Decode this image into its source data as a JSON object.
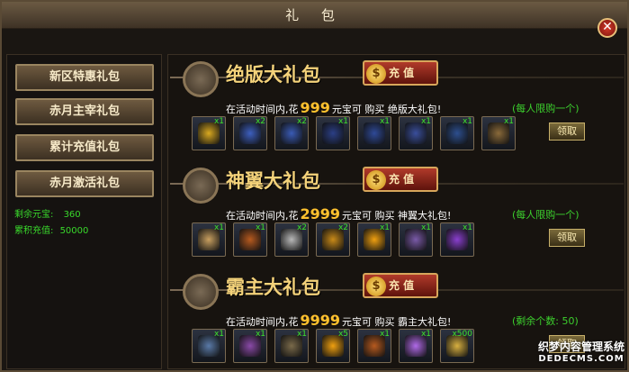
{
  "window": {
    "title": "礼 包",
    "close_glyph": "✕"
  },
  "sidebar": {
    "items": [
      {
        "label": "新区特惠礼包"
      },
      {
        "label": "赤月主宰礼包"
      },
      {
        "label": "累计充值礼包"
      },
      {
        "label": "赤月激活礼包"
      }
    ],
    "remaining_label": "剩余元宝:",
    "remaining_value": "360",
    "total_label": "累积充值:",
    "total_value": "50000"
  },
  "packs": [
    {
      "title": "绝版大礼包",
      "charge_label": "充 值",
      "desc_prefix": "在活动时间内,花",
      "price": "999",
      "desc_suffix": "元宝可 购买 绝版大礼包!",
      "limit": "(每人限购一个)",
      "claim_label": "领取",
      "items": [
        {
          "icon": "gold-token-icon",
          "count": "x1",
          "color": "#d9a920"
        },
        {
          "icon": "gold-helmet-icon",
          "count": "x2",
          "color": "#3d5fbf"
        },
        {
          "icon": "blue-armor-icon",
          "count": "x2",
          "color": "#3a5bb5"
        },
        {
          "icon": "gold-armor-icon",
          "count": "x1",
          "color": "#2b3f86"
        },
        {
          "icon": "gauntlet-icon",
          "count": "x1",
          "color": "#2f4a98"
        },
        {
          "icon": "gold-boots-icon",
          "count": "x1",
          "color": "#3a4f9c"
        },
        {
          "icon": "blue-weapon-icon",
          "count": "x1",
          "color": "#2d4f8f"
        },
        {
          "icon": "treasure-chest-icon",
          "count": "x1",
          "color": "#8a6a3a"
        }
      ]
    },
    {
      "title": "神翼大礼包",
      "charge_label": "充 值",
      "desc_prefix": "在活动时间内,花",
      "price": "2999",
      "desc_suffix": "元宝可 购买 神翼大礼包!",
      "limit": "(每人限购一个)",
      "claim_label": "领取",
      "items": [
        {
          "icon": "wings-icon",
          "count": "x1",
          "color": "#c9a060"
        },
        {
          "icon": "scroll-icon",
          "count": "x1",
          "color": "#b75a1f"
        },
        {
          "icon": "white-scroll-icon",
          "count": "x2",
          "color": "#b8b8b8"
        },
        {
          "icon": "gold-scroll-icon",
          "count": "x2",
          "color": "#c98a18"
        },
        {
          "icon": "gold-coupon-icon",
          "count": "x1",
          "color": "#f0a010"
        },
        {
          "icon": "double-badge-icon",
          "count": "x1",
          "color": "#7a5aa8"
        },
        {
          "icon": "exp-orb-icon",
          "count": "x1",
          "color": "#8a3fcf"
        }
      ]
    },
    {
      "title": "霸主大礼包",
      "charge_label": "充 值",
      "desc_prefix": "在活动时间内,花",
      "price": "9999",
      "desc_suffix": "元宝可 购买 霸主大礼包!",
      "limit": "(剩余个数: 50)",
      "claim_label": "领取",
      "items": [
        {
          "icon": "ring-icon",
          "count": "x1",
          "color": "#5a7aa8"
        },
        {
          "icon": "medal-icon",
          "count": "x1",
          "color": "#8a4aa8"
        },
        {
          "icon": "round-shield-icon",
          "count": "x1",
          "color": "#7a6a4a"
        },
        {
          "icon": "gold-coupon-icon",
          "count": "x5",
          "color": "#f0a010"
        },
        {
          "icon": "scroll-icon",
          "count": "x1",
          "color": "#b75a1f"
        },
        {
          "icon": "purple-orb-icon",
          "count": "x1",
          "color": "#b06ae8"
        },
        {
          "icon": "gold-arrow-icon",
          "count": "x500",
          "color": "#d8b040"
        }
      ]
    }
  ],
  "watermark": {
    "line1": "织梦内容管理系统",
    "line2": "DEDECMS.COM"
  }
}
